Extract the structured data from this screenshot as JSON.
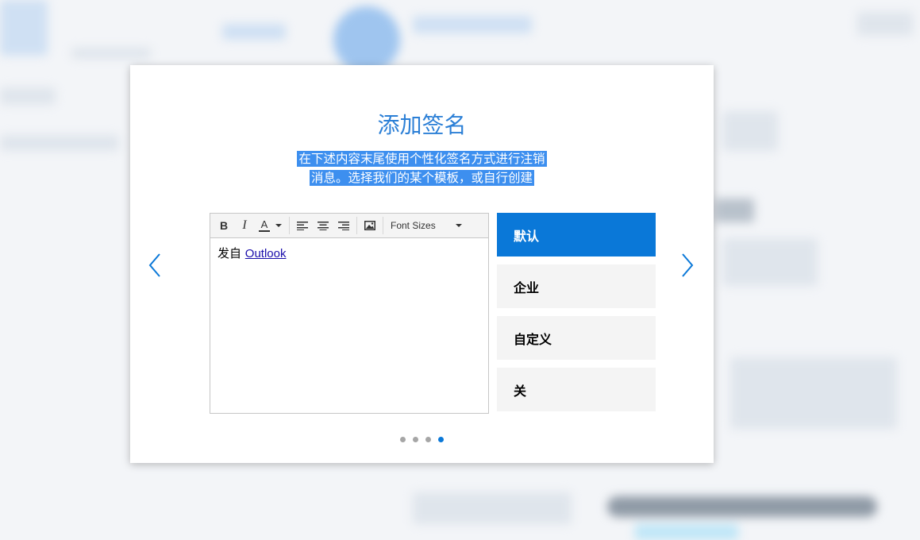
{
  "dialog": {
    "title": "添加签名",
    "description_line1": "在下述内容末尾使用个性化签名方式进行注销",
    "description_line2": "消息。选择我们的某个模板，或自行创建"
  },
  "editor": {
    "toolbar": {
      "bold": "B",
      "italic": "I",
      "font_color": "A",
      "font_sizes": "Font Sizes"
    },
    "body_prefix": "发自",
    "body_link": "Outlook"
  },
  "options": [
    {
      "label": "默认",
      "selected": true
    },
    {
      "label": "企业",
      "selected": false
    },
    {
      "label": "自定义",
      "selected": false
    },
    {
      "label": "关",
      "selected": false
    }
  ],
  "pagination": {
    "total": 4,
    "current": 4
  },
  "colors": {
    "accent": "#0a78d8",
    "title": "#2b7fd6",
    "selection": "#3d8fef"
  },
  "icons": [
    "chevron-left-icon",
    "chevron-right-icon",
    "align-left-icon",
    "align-center-icon",
    "align-right-icon",
    "image-icon",
    "caret-down-icon"
  ]
}
